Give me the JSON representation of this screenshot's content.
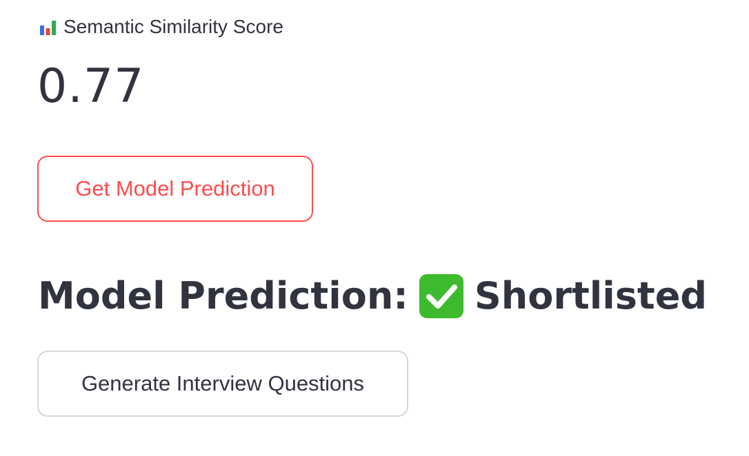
{
  "metric": {
    "icon": "bar-chart-icon",
    "label": "Semantic Similarity Score",
    "value": "0.77"
  },
  "predict_button": {
    "label": "Get Model Prediction",
    "accent_color": "#ff4b4b"
  },
  "prediction": {
    "prefix": "Model Prediction:",
    "status_icon": "check-mark-button-icon",
    "status_icon_color": "#3dba2e",
    "status": "Shortlisted"
  },
  "questions_button": {
    "label": "Generate Interview Questions"
  }
}
